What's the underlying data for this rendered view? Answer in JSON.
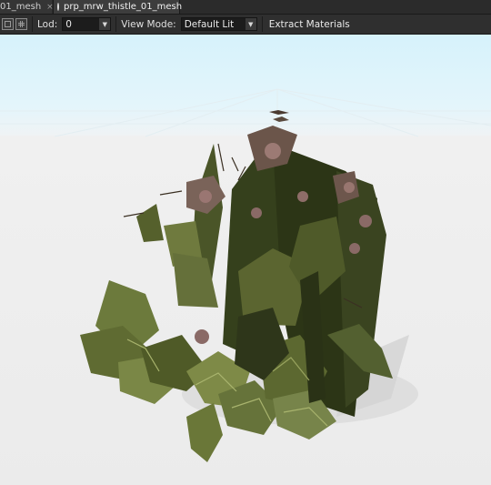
{
  "tabs": [
    {
      "label": "01_mesh",
      "active": false,
      "close": "×"
    },
    {
      "label": "prp_mrw_thistle_01_mesh",
      "active": true,
      "icon": "mesh-ring-icon"
    }
  ],
  "toolbar": {
    "buttons": [
      "wireframe-toggle-icon",
      "grid-toggle-icon"
    ],
    "lod_label": "Lod:",
    "lod_value": "0",
    "view_mode_label": "View Mode:",
    "view_mode_value": "Default Lit",
    "extract_label": "Extract Materials",
    "dropdown_arrow": "▼"
  },
  "viewport": {
    "subject": "thistle mesh preview",
    "colors": {
      "sky_top": "#d6f2fb",
      "floor": "#ebebeb",
      "leaf_dark": "#3f4a22",
      "leaf_light": "#7e8a47",
      "flower": "#8a6a66"
    }
  }
}
